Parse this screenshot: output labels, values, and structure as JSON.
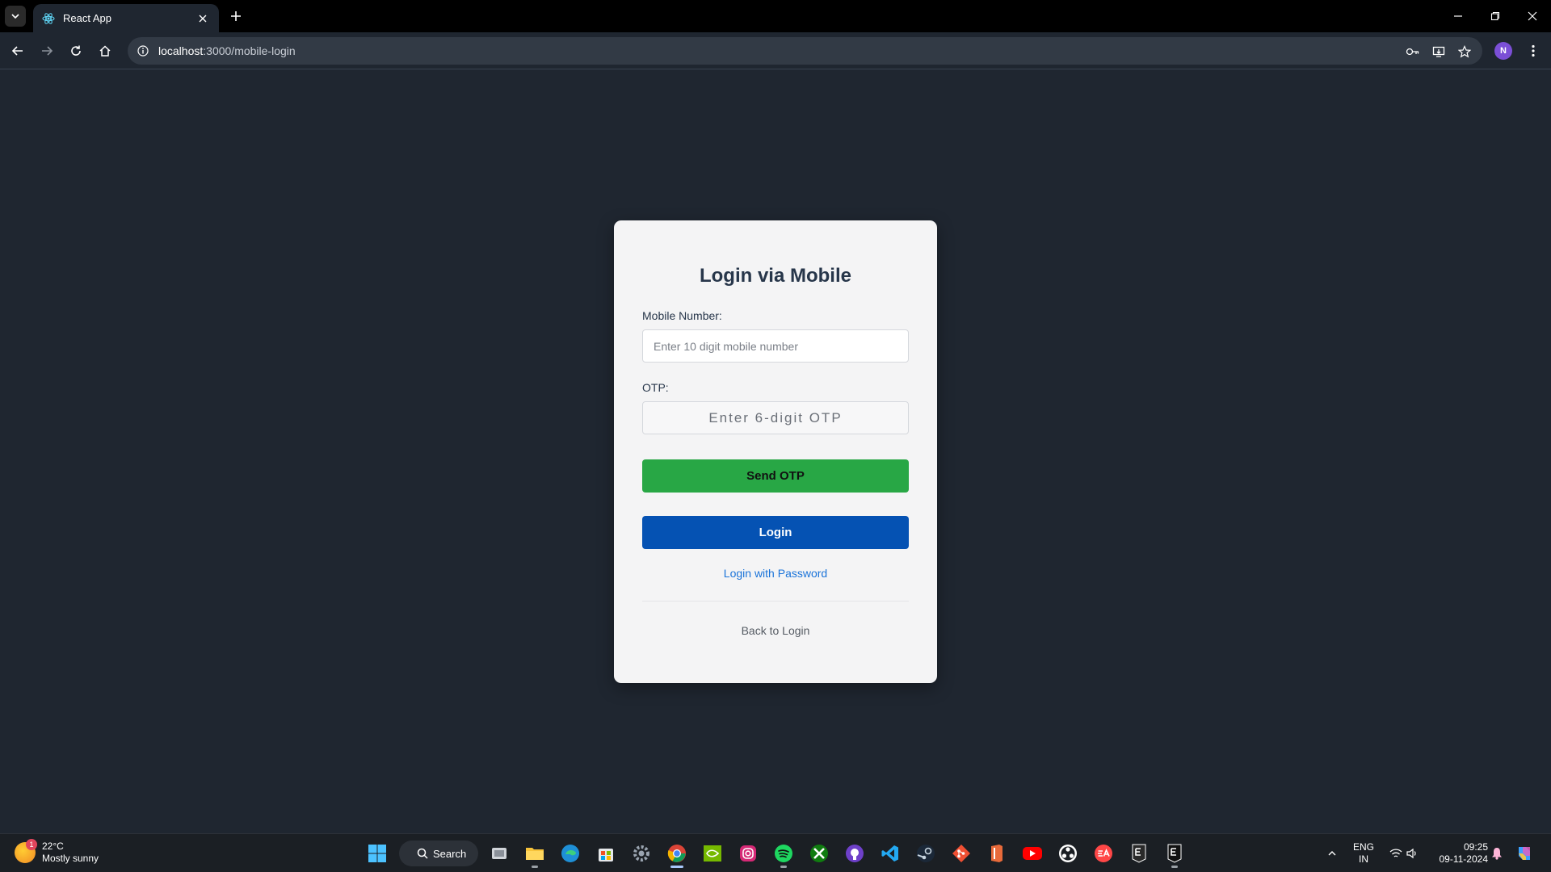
{
  "browser": {
    "tab_title": "React App",
    "url_host": "localhost",
    "url_rest": ":3000/mobile-login",
    "profile_initial": "N"
  },
  "login": {
    "title": "Login via Mobile",
    "mobile_label": "Mobile Number:",
    "mobile_placeholder": "Enter 10 digit mobile number",
    "mobile_value": "",
    "otp_label": "OTP:",
    "otp_placeholder": "Enter 6-digit OTP",
    "otp_value": "",
    "send_otp_label": "Send OTP",
    "login_label": "Login",
    "password_link": "Login with Password",
    "back_link": "Back to Login"
  },
  "colors": {
    "page_bg": "#1f2630",
    "send_button": "#28a745",
    "login_button": "#0552b3",
    "link": "#1a73d9"
  },
  "taskbar": {
    "temperature": "22°C",
    "weather": "Mostly sunny",
    "weather_badge": "1",
    "search_label": "Search",
    "lang_top": "ENG",
    "lang_bottom": "IN",
    "time": "09:25",
    "date": "09-11-2024",
    "apps": [
      "windows-start-icon",
      "file-explorer-icon",
      "folder-icon",
      "edge-icon",
      "store-icon",
      "settings-icon",
      "chrome-icon",
      "nvidia-icon",
      "instagram-icon",
      "spotify-icon",
      "xbox-icon",
      "github-icon",
      "vscode-icon",
      "steam-icon",
      "git-icon",
      "office-icon",
      "youtube-icon",
      "obs-icon",
      "ea-icon",
      "epic-icon",
      "epic-games-icon"
    ]
  }
}
